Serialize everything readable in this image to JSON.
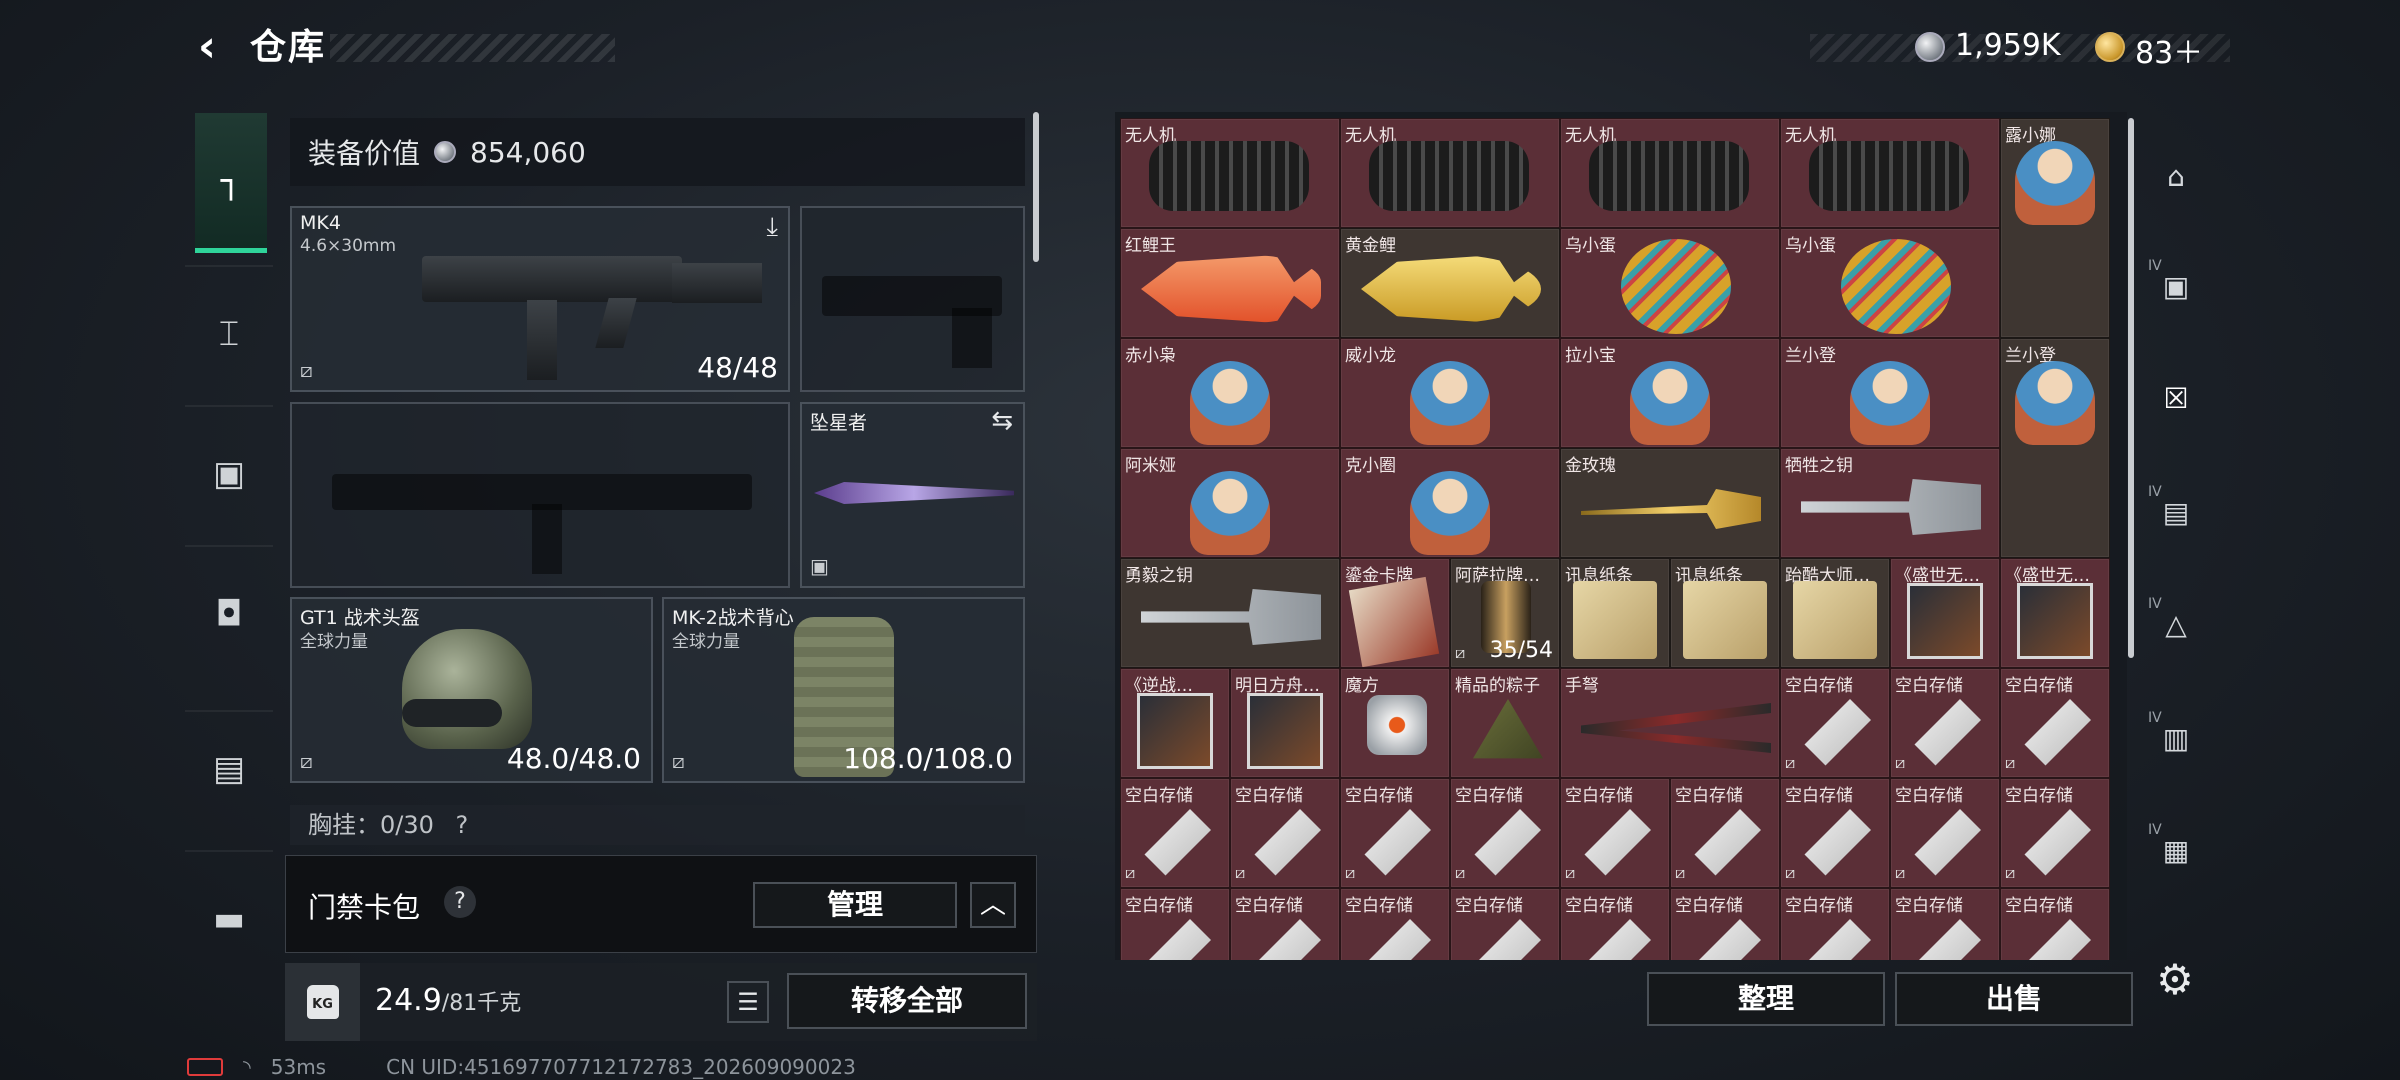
{
  "header": {
    "back_icon": "chevron-left-icon",
    "title": "仓库",
    "currency_silver": "1,959K",
    "currency_gold": "83＋"
  },
  "left_nav": {
    "items": [
      {
        "icon": "pistol-icon",
        "active": true
      },
      {
        "icon": "vest-icon",
        "active": false
      },
      {
        "icon": "backpack-rig-icon",
        "active": false
      },
      {
        "icon": "backpack-icon",
        "active": false
      },
      {
        "icon": "case-icon",
        "active": false
      },
      {
        "icon": "toolbox-icon",
        "active": false
      }
    ]
  },
  "equipment": {
    "value_label": "装备价值",
    "value": "854,060",
    "primary_weapon": {
      "name": "MK4",
      "caliber": "4.6×30mm",
      "ammo": "48/48"
    },
    "melee": {
      "name": "坠星者"
    },
    "helmet": {
      "name": "GT1 战术头盔",
      "brand": "全球力量",
      "durability": "48.0/48.0"
    },
    "armor": {
      "name": "MK-2战术背心",
      "brand": "全球力量",
      "durability": "108.0/108.0"
    },
    "pocket_label": "胸挂：0/30",
    "pocket_help": "?"
  },
  "card_bar": {
    "label": "门禁卡包",
    "help": "?",
    "manage": "管理",
    "collapse": "︿"
  },
  "weight": {
    "icon": "KG",
    "current": "24.9",
    "max": "/81千克",
    "transfer": "转移全部"
  },
  "status": {
    "ping": "53ms",
    "uid": "CN UID:451697707712172783_202609090023"
  },
  "inventory": {
    "items": [
      {
        "name": "无人机",
        "art": "drone"
      },
      {
        "name": "无人机",
        "art": "drone"
      },
      {
        "name": "无人机",
        "art": "drone"
      },
      {
        "name": "无人机",
        "art": "drone"
      },
      {
        "name": "露小娜",
        "art": "figure"
      },
      {
        "name": "红鲤王",
        "art": "fish-red"
      },
      {
        "name": "黄金鲤",
        "art": "fish-gold"
      },
      {
        "name": "乌小蛋",
        "art": "egg"
      },
      {
        "name": "乌小蛋",
        "art": "egg"
      },
      {
        "name": "赤小枭",
        "art": "figure"
      },
      {
        "name": "威小龙",
        "art": "figure"
      },
      {
        "name": "拉小宝",
        "art": "figure"
      },
      {
        "name": "兰小登",
        "art": "figure"
      },
      {
        "name": "兰小登",
        "art": "figure"
      },
      {
        "name": "阿米娅",
        "art": "figure"
      },
      {
        "name": "克小圈",
        "art": "figure"
      },
      {
        "name": "金玫瑰",
        "art": "rose"
      },
      {
        "name": "牺牲之钥",
        "art": "key"
      },
      {
        "name": "勇毅之钥",
        "art": "key"
      },
      {
        "name": "鎏金卡牌",
        "art": "card"
      },
      {
        "name": "阿萨拉牌…",
        "art": "lighter",
        "count": "35/54"
      },
      {
        "name": "讯息纸条",
        "art": "paper"
      },
      {
        "name": "讯息纸条",
        "art": "paper"
      },
      {
        "name": "跆酷大师…",
        "art": "paper"
      },
      {
        "name": "《盛世无…",
        "art": "album"
      },
      {
        "name": "《盛世无…",
        "art": "album"
      },
      {
        "name": "《逆战…",
        "art": "album"
      },
      {
        "name": "明日方舟…",
        "art": "album"
      },
      {
        "name": "魔方",
        "art": "cube"
      },
      {
        "name": "精品的粽子",
        "art": "zongzi"
      },
      {
        "name": "手弩",
        "art": "crossbow"
      },
      {
        "name": "空白存储",
        "art": "usb"
      }
    ],
    "filler_name": "空白存储"
  },
  "buttons": {
    "sort": "整理",
    "sell": "出售"
  },
  "right_nav": {
    "tiers": [
      "",
      "IV",
      "",
      "IV",
      "IV",
      "IV",
      "IV"
    ],
    "icons": [
      "safe-icon",
      "camera-stash-icon",
      "tag-stash-icon",
      "box-stash-icon",
      "trophy-stash-icon",
      "folder-stash-icon",
      "crate-stash-icon"
    ]
  },
  "colors": {
    "accent_green": "#2fd49a",
    "cell_red": "#5b2f37",
    "cell_brown": "#3e3631"
  }
}
